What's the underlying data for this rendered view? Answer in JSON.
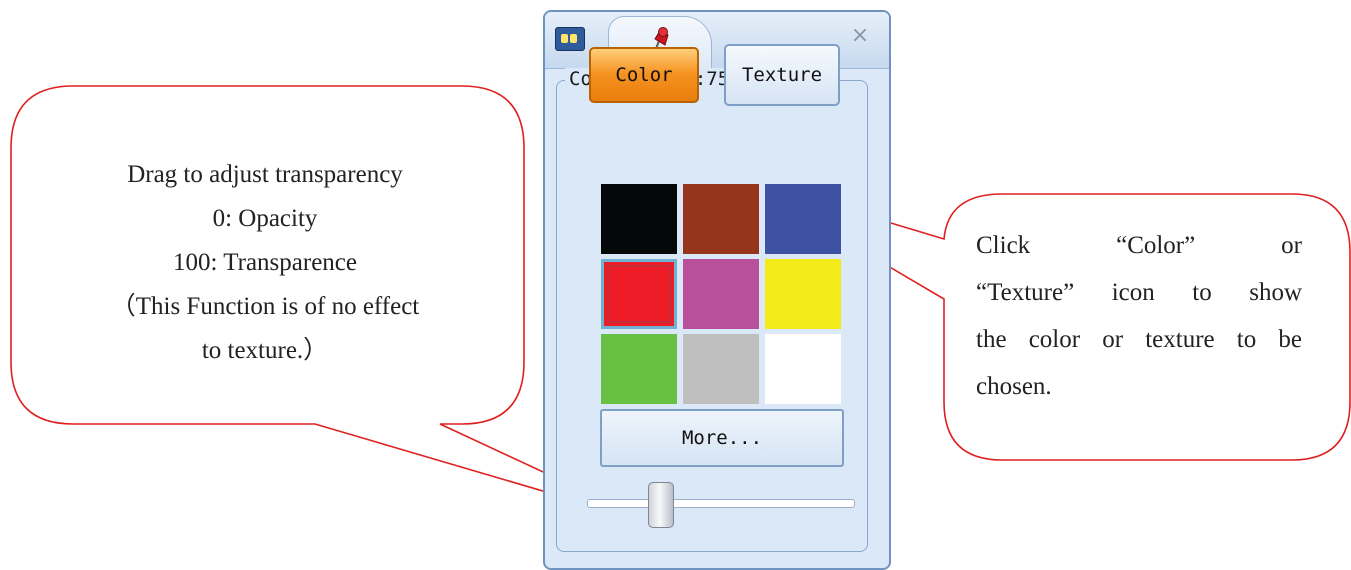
{
  "window": {
    "group_title": "Color-Trans:75%",
    "transparency_percent": 75,
    "buttons": {
      "color": "Color",
      "texture": "Texture",
      "more": "More..."
    },
    "active_mode": "Color",
    "swatches": [
      {
        "name": "black",
        "color": "#050808"
      },
      {
        "name": "brown",
        "color": "#96351c"
      },
      {
        "name": "blue",
        "color": "#3e52a4"
      },
      {
        "name": "red",
        "color": "#ee1c26",
        "selected": true
      },
      {
        "name": "pink",
        "color": "#b9509b"
      },
      {
        "name": "yellow",
        "color": "#f3ea1a"
      },
      {
        "name": "green",
        "color": "#69c143"
      },
      {
        "name": "gray",
        "color": "#bfbfbf"
      },
      {
        "name": "white",
        "color": "#ffffff"
      }
    ],
    "slider_value": 25,
    "icons": {
      "app": "app-icon",
      "pin": "pushpin-icon",
      "close": "close-icon"
    },
    "close_glyph": "×"
  },
  "callouts": {
    "left": {
      "lines": [
        "Drag to adjust transparency",
        "0: Opacity",
        "100: Transparence",
        "（This Function is of no effect",
        "to texture.）"
      ]
    },
    "right": {
      "lines": [
        "Click “Color” or",
        "“Texture” icon to show",
        "the color or texture to be",
        "chosen."
      ]
    },
    "outline_color": "#e02020"
  }
}
